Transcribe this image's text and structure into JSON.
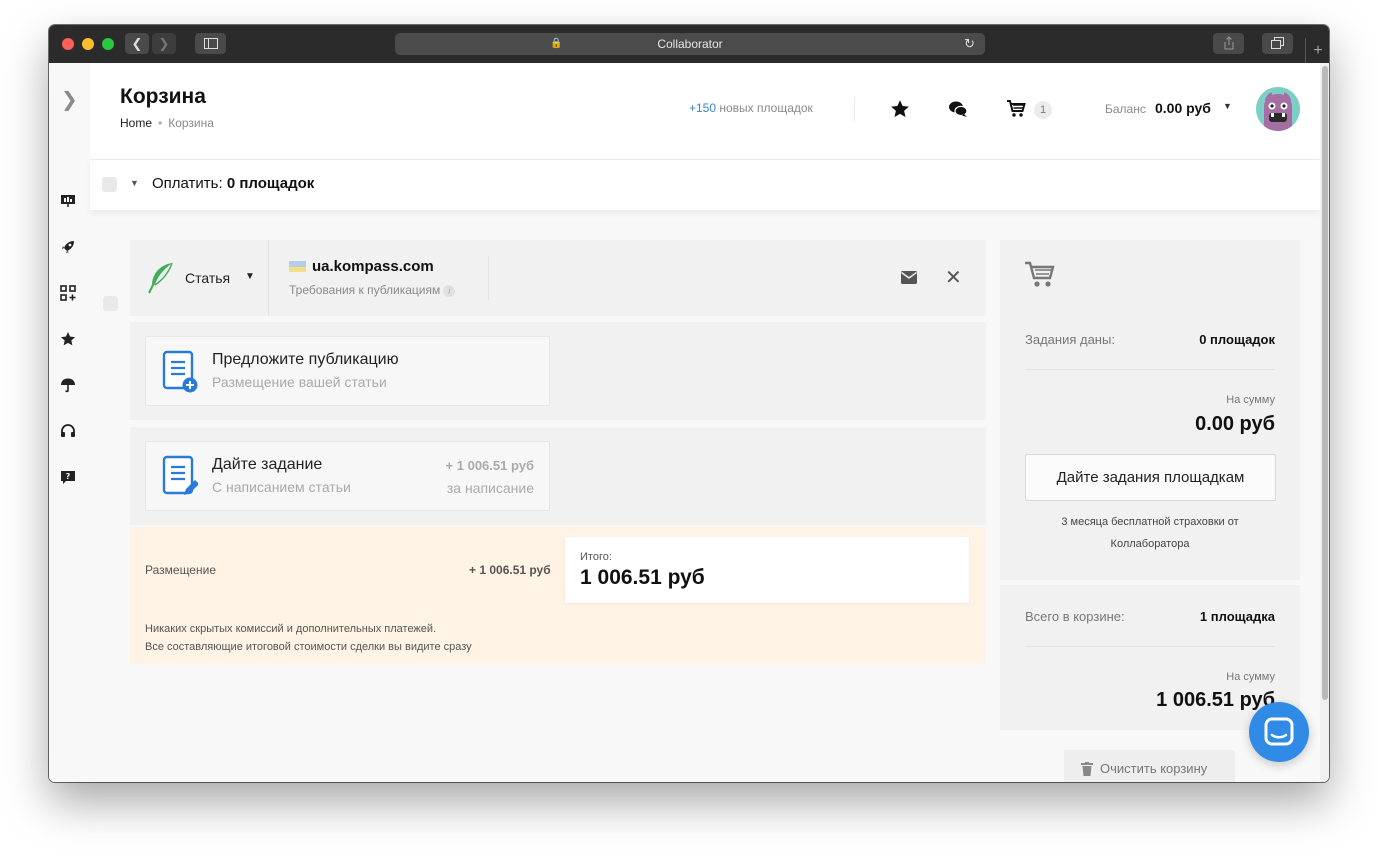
{
  "browser": {
    "title": "Collaborator"
  },
  "header": {
    "title": "Корзина",
    "breadcrumb": [
      "Home",
      "Корзина"
    ],
    "new_sites_count": "+150",
    "new_sites_text": "новых площадок",
    "cart_count": "1",
    "balance_label": "Баланс",
    "balance_value": "0.00 руб"
  },
  "paybar": {
    "label": "Оплатить:",
    "value": "0 площадок"
  },
  "site": {
    "type": "Статья",
    "name": "ua.kompass.com",
    "requirements": "Требования к публикациям",
    "info_glyph": "i"
  },
  "options": [
    {
      "title": "Предложите публикацию",
      "subtitle": "Размещение вашей статьи"
    },
    {
      "title": "Дайте задание",
      "subtitle": "С написанием статьи",
      "price": "+ 1 006.51 руб",
      "price_note": "за написание"
    }
  ],
  "summary": {
    "placement_label": "Размещение",
    "placement_value": "+ 1 006.51 руб",
    "total_label": "Итого:",
    "total_value": "1 006.51 руб",
    "note_line1": "Никаких скрытых комиссий и дополнительных платежей.",
    "note_line2": "Все составляющие итоговой стоимости сделки вы видите сразу"
  },
  "sidebar_right": {
    "tasks_label": "Задания даны:",
    "tasks_value": "0 площадок",
    "sum_label_1": "На сумму",
    "sum_value_1": "0.00 руб",
    "button": "Дайте задания площадкам",
    "insurance": "3 месяца бесплатной страховки от Коллаборатора",
    "total_label": "Всего в корзине:",
    "total_value": "1 площадка",
    "sum_label_2": "На сумму",
    "sum_value_2": "1 006.51 руб",
    "clear_button": "Очистить корзину"
  },
  "colors": {
    "accent": "#3b86d4",
    "feather": "#3fae5a",
    "summary_bg": "#fef3e5",
    "chat_fab": "#2f8be6"
  },
  "icons": {
    "nav": [
      "presentation-icon",
      "rocket-icon",
      "apps-icon",
      "star-icon",
      "umbrella-icon",
      "headset-icon",
      "help-chat-icon"
    ],
    "header": [
      "star-icon",
      "chat-icon",
      "cart-icon"
    ]
  }
}
